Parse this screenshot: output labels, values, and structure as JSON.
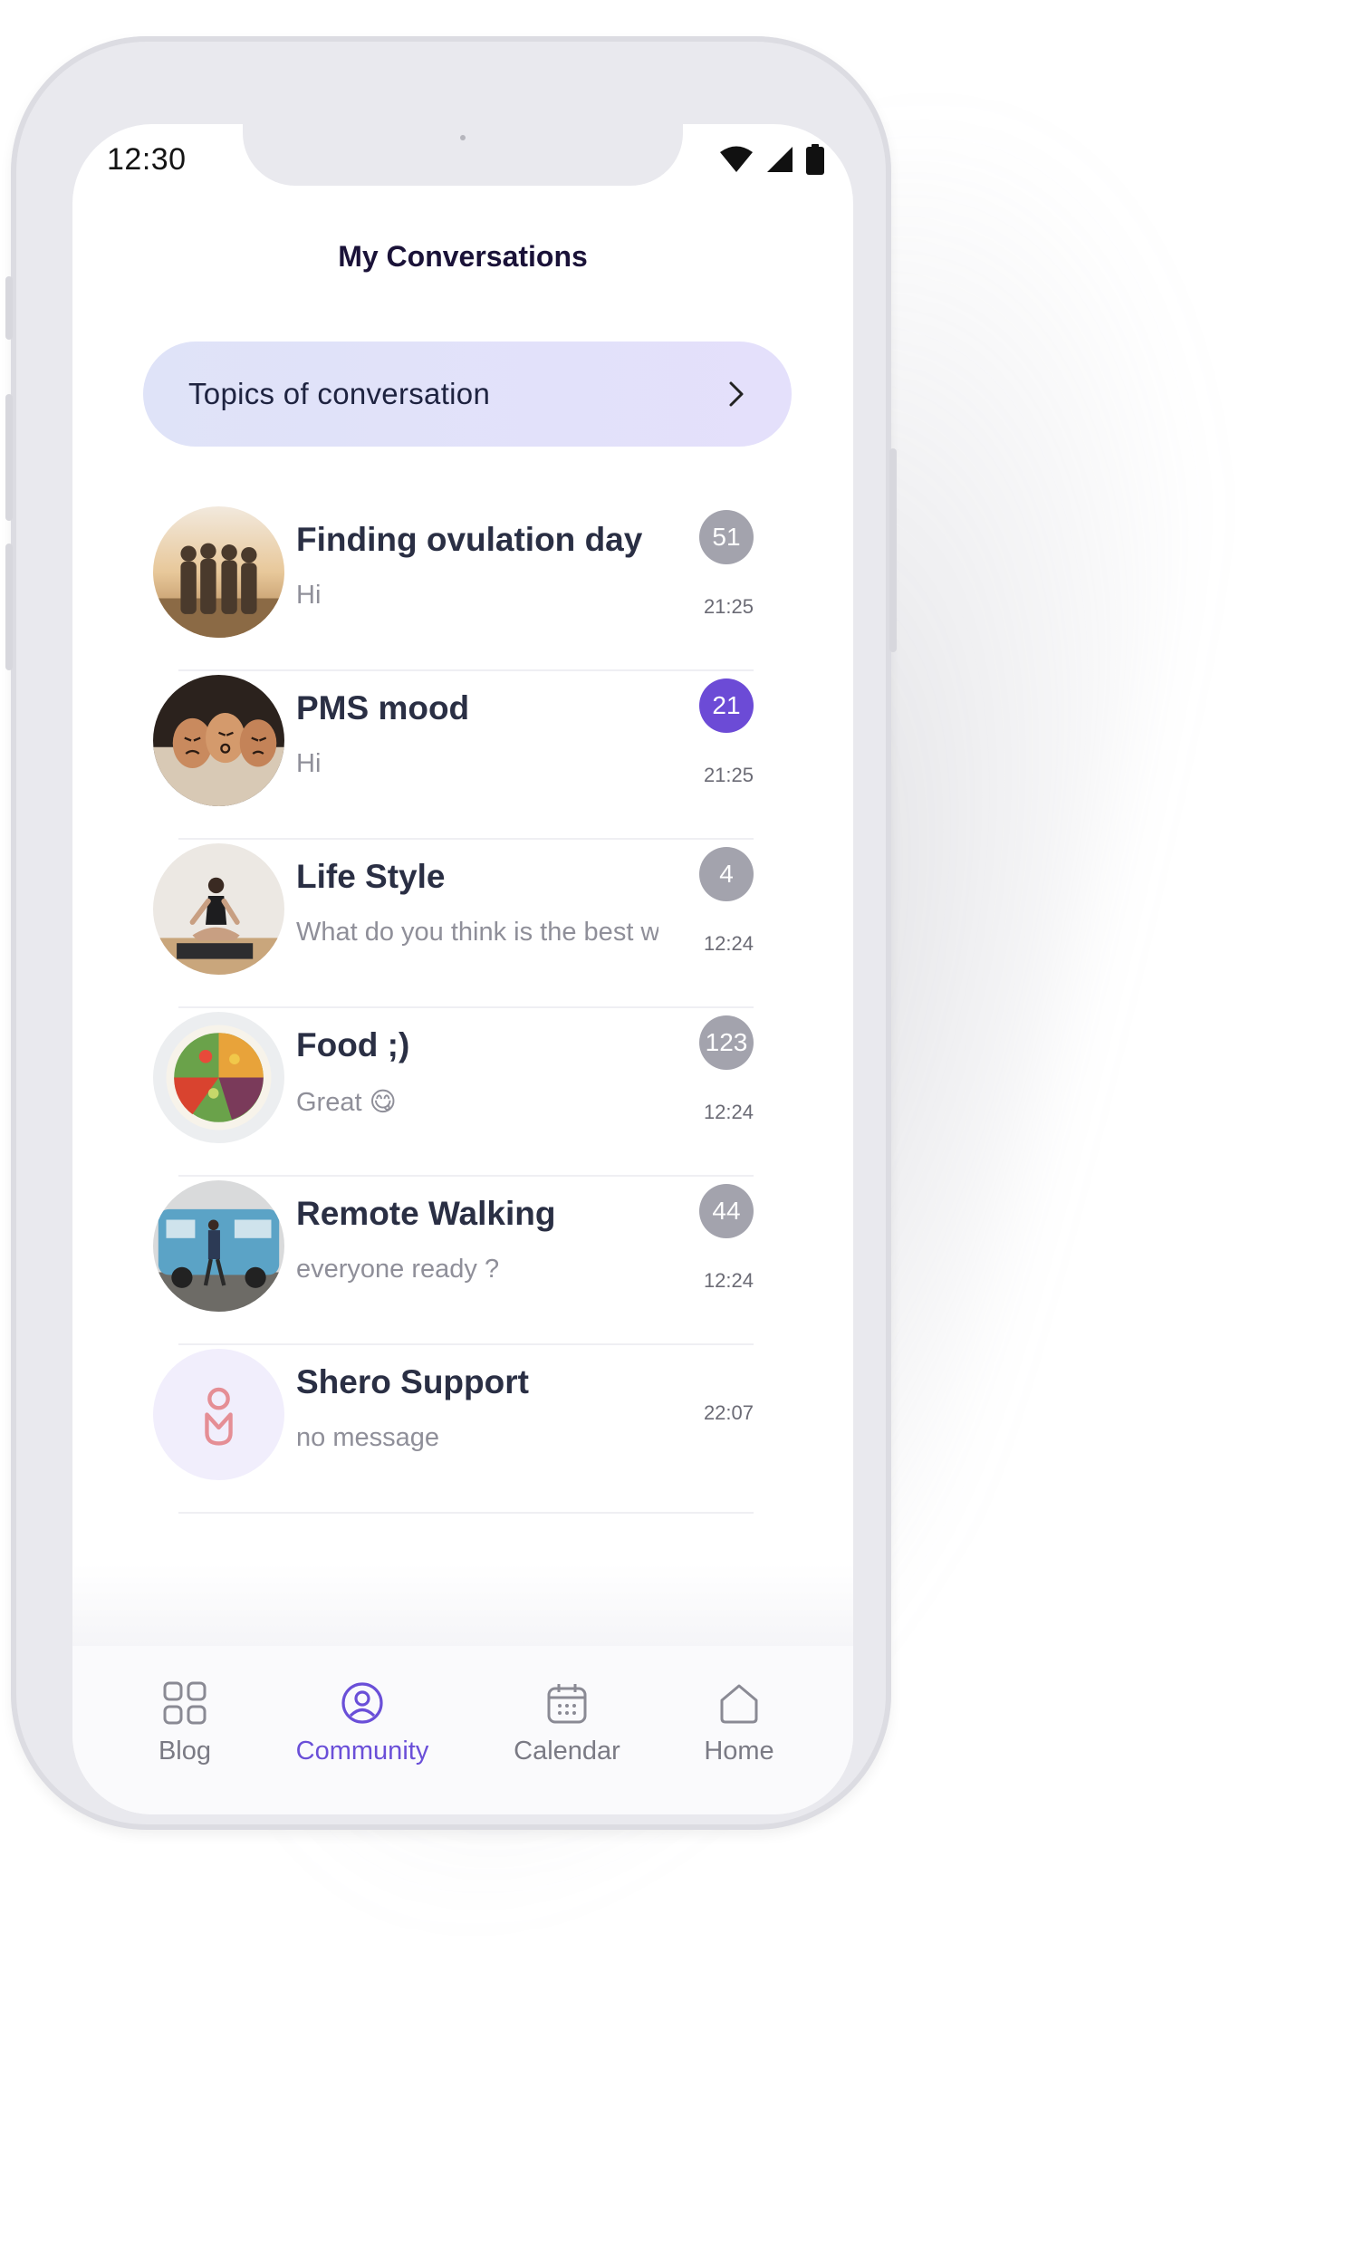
{
  "status_bar": {
    "time": "12:30"
  },
  "header": {
    "title": "My Conversations"
  },
  "topics_button": {
    "label": "Topics of conversation"
  },
  "conversations": [
    {
      "title": "Finding ovulation day",
      "preview": "Hi",
      "badge": "51",
      "time": "21:25"
    },
    {
      "title": "PMS mood",
      "preview": "Hi",
      "badge": "21",
      "time": "21:25"
    },
    {
      "title": "Life Style",
      "preview": "What do you think is the best w",
      "badge": "4",
      "time": "12:24"
    },
    {
      "title": "Food ;)",
      "preview": "Great 😋",
      "badge": "123",
      "time": "12:24"
    },
    {
      "title": "Remote Walking",
      "preview": "everyone ready ?",
      "badge": "44",
      "time": "12:24"
    },
    {
      "title": "Shero Support",
      "preview": "no message",
      "badge": "",
      "time": "22:07"
    }
  ],
  "tab_bar": {
    "tabs": [
      {
        "label": "Blog",
        "icon": "grid-icon",
        "active": false
      },
      {
        "label": "Community",
        "icon": "user-circle-icon",
        "active": true
      },
      {
        "label": "Calendar",
        "icon": "calendar-icon",
        "active": false
      },
      {
        "label": "Home",
        "icon": "home-icon",
        "active": false
      }
    ]
  },
  "colors": {
    "accent": "#6a4fd8",
    "badge_active": "#6c4bd6",
    "badge_muted": "#a3a3ad",
    "title_text": "#2a2f44",
    "muted_text": "#8f8f99"
  }
}
